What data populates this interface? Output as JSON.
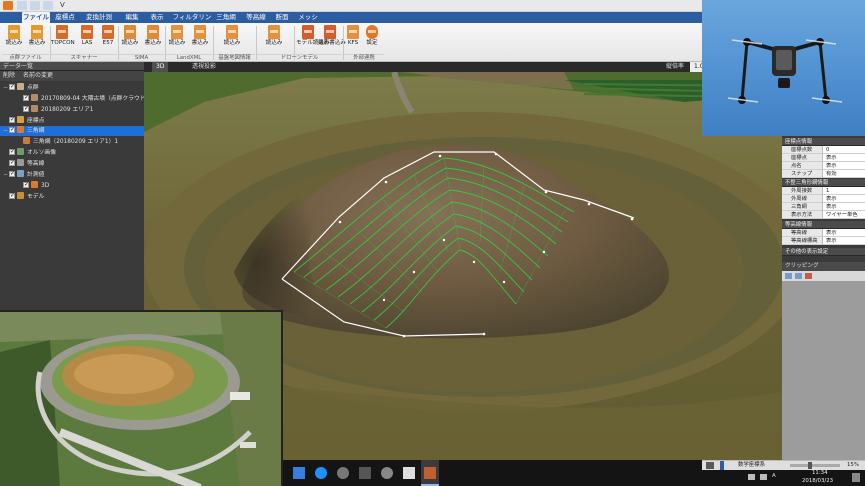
{
  "window": {
    "title": "V"
  },
  "ribbon_tabs": [
    "ファイル",
    "座標点",
    "変換計測",
    "編集",
    "表示",
    "フィルタリング",
    "三角網",
    "等高線",
    "断面",
    "メッシュ"
  ],
  "ribbon_buttons": [
    {
      "label": "読込み",
      "tag": "TXT"
    },
    {
      "label": "書込み",
      "tag": "TXT"
    },
    {
      "label": "TOPCON",
      "tag": ""
    },
    {
      "label": "LAS",
      "tag": "LAS"
    },
    {
      "label": "E57",
      "tag": "E57"
    },
    {
      "label": "読込み",
      "tag": "SIMA"
    },
    {
      "label": "書込み",
      "tag": "SIMA"
    },
    {
      "label": "読込み",
      "tag": "XML"
    },
    {
      "label": "書込み",
      "tag": "XML"
    },
    {
      "label": "読込み",
      "tag": "XML"
    },
    {
      "label": "読込み",
      "tag": "XML"
    },
    {
      "label": "モデル読込み",
      "tag": ""
    },
    {
      "label": "撮影書込み",
      "tag": ""
    },
    {
      "label": "KFS",
      "tag": "KFS"
    },
    {
      "label": "設定",
      "tag": ""
    }
  ],
  "ribbon_groups": [
    "点群ファイル",
    "スキャナー",
    "SIMA",
    "LandXML",
    "基盤地図情報",
    "ドローンモデル",
    "外部連携"
  ],
  "left_panel": {
    "title": "データ一覧",
    "tools": [
      "削除",
      "名前の変更"
    ],
    "tree": [
      {
        "label": "点群"
      },
      {
        "label": "20170809-04  大隈古墳（点群クラウド）"
      },
      {
        "label": "20180209  エリア1"
      },
      {
        "label": "座標点"
      },
      {
        "label": "三角網"
      },
      {
        "label": "三角網（20180209  エリア1）1"
      },
      {
        "label": "オルソ画像"
      },
      {
        "label": "等高線"
      },
      {
        "label": "計測値"
      },
      {
        "label": "3D"
      },
      {
        "label": "モデル"
      }
    ]
  },
  "view_tabs": [
    "3D",
    "透視投影"
  ],
  "view_extra": {
    "label": "縦倍率",
    "value": "1.0"
  },
  "right_panel": {
    "sections": [
      {
        "title": "座標点情報",
        "rows": [
          [
            "座標点数",
            "0"
          ],
          [
            "座標点",
            "表示"
          ],
          [
            "点名",
            "表示"
          ],
          [
            "スナップ",
            "有効"
          ]
        ]
      },
      {
        "title": "不整三角形網情報",
        "rows": [
          [
            "外周接数",
            "1"
          ],
          [
            "外周線",
            "表示"
          ],
          [
            "三角網",
            "表示"
          ],
          [
            "表示方法",
            "ワイヤー単色"
          ]
        ]
      },
      {
        "title": "等高線情報",
        "rows": [
          [
            "等高線",
            "表示"
          ],
          [
            "等高線標高",
            "表示"
          ]
        ]
      },
      {
        "title": "その他の表示設定",
        "rows": []
      }
    ],
    "clip_title": "クリッピング"
  },
  "status": {
    "coord_label": "数学座標系",
    "zoom": "15%"
  },
  "taskbar": {
    "time": "11:34",
    "date": "2018/03/23",
    "ime": "A"
  },
  "colors": {
    "ribbon_blue": "#2d5da1",
    "selection": "#1e6fd9",
    "wire": "#ffffff",
    "contour_green": "#33d040"
  }
}
